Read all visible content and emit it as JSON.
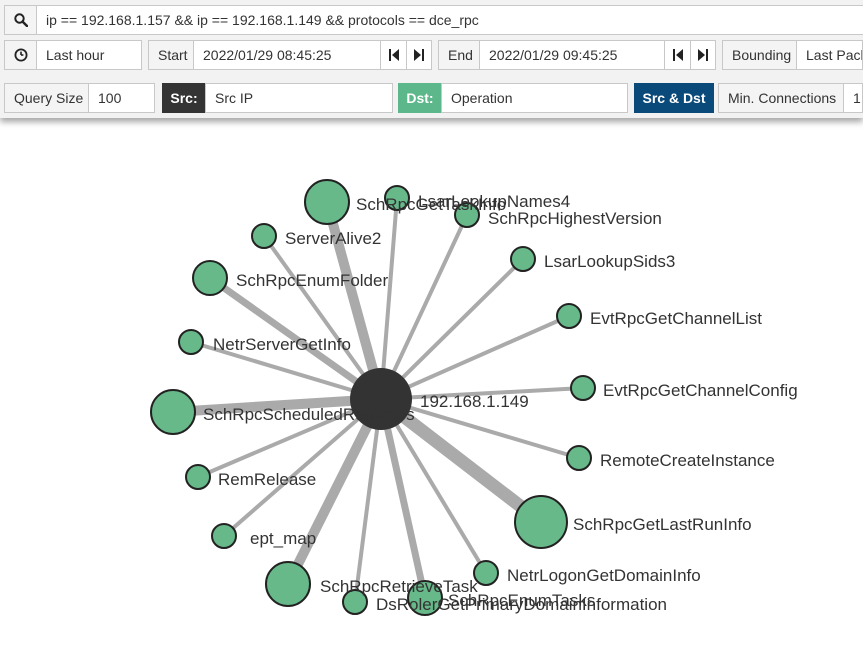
{
  "search": {
    "query": "ip == 192.168.1.157 && ip == 192.168.1.149 && protocols == dce_rpc",
    "icon": "search-icon"
  },
  "time": {
    "range": "Last hour",
    "start_label": "Start",
    "start_value": "2022/01/29 08:45:25",
    "end_label": "End",
    "end_value": "2022/01/29 09:45:25",
    "bounding_label": "Bounding",
    "bounding_value": "Last Pack"
  },
  "options": {
    "query_size_label": "Query Size",
    "query_size_value": "100",
    "src_label": "Src:",
    "src_value": "Src IP",
    "dst_label": "Dst:",
    "dst_value": "Operation",
    "src_dst_button": "Src & Dst",
    "min_conn_label": "Min. Connections",
    "min_conn_value": "1"
  },
  "colors": {
    "center": "#333333",
    "node": "#67b98a",
    "edge": "#aaaaaa",
    "dst_label": "#5cb88a",
    "src_label": "#343434",
    "button": "#0a4a7a"
  },
  "graph": {
    "center": {
      "label": "192.168.1.149"
    },
    "nodes": [
      {
        "label": "SchRpcGetTaskInfo",
        "weight": 3
      },
      {
        "label": "LsarLookupNames4",
        "weight": 1
      },
      {
        "label": "SchRpcHighestVersion",
        "weight": 1
      },
      {
        "label": "ServerAlive2",
        "weight": 1
      },
      {
        "label": "LsarLookupSids3",
        "weight": 1
      },
      {
        "label": "SchRpcEnumFolder",
        "weight": 2
      },
      {
        "label": "EvtRpcGetChannelList",
        "weight": 1
      },
      {
        "label": "NetrServerGetInfo",
        "weight": 1
      },
      {
        "label": "EvtRpcGetChannelConfig",
        "weight": 1
      },
      {
        "label": "SchRpcScheduledRuntimes",
        "weight": 3
      },
      {
        "label": "RemoteCreateInstance",
        "weight": 1
      },
      {
        "label": "RemRelease",
        "weight": 1
      },
      {
        "label": "SchRpcGetLastRunInfo",
        "weight": 4
      },
      {
        "label": "ept_map",
        "weight": 1
      },
      {
        "label": "NetrLogonGetDomainInfo",
        "weight": 1
      },
      {
        "label": "SchRpcRetrieveTask",
        "weight": 3
      },
      {
        "label": "SchRpcEnumTasks",
        "weight": 2
      },
      {
        "label": "DsRolerGetPrimaryDomainInformation",
        "weight": 1
      }
    ]
  }
}
